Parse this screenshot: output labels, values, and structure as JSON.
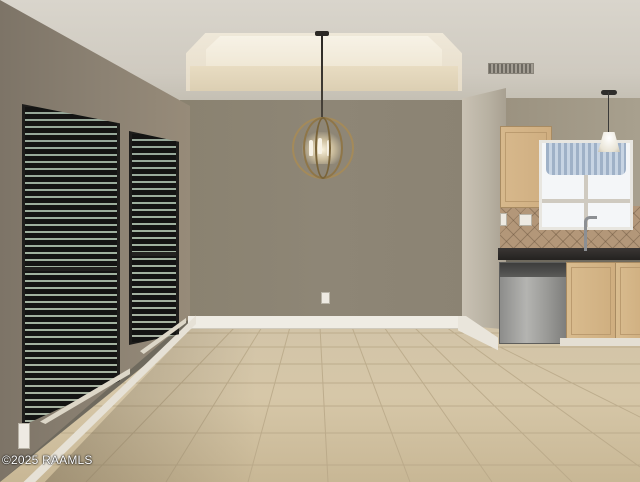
{
  "photo": {
    "watermark": "©2025 RAAMLS"
  }
}
